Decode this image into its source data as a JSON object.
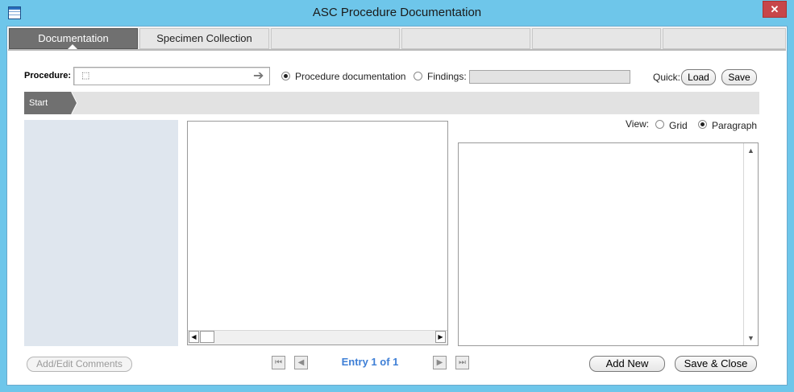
{
  "window": {
    "title": "ASC Procedure Documentation",
    "close_glyph": "✕",
    "app_icon": "app-window-icon"
  },
  "tabs": [
    {
      "label": "Documentation",
      "active": true
    },
    {
      "label": "Specimen Collection",
      "active": false
    },
    {
      "label": "",
      "active": false
    },
    {
      "label": "",
      "active": false
    },
    {
      "label": "",
      "active": false
    },
    {
      "label": "",
      "active": false
    }
  ],
  "procedure": {
    "label": "Procedure:",
    "value": "",
    "search_icon": "lookup-icon",
    "go_glyph": "➔"
  },
  "mode": {
    "procedure_doc_label": "Procedure documentation",
    "findings_label": "Findings:",
    "selected": "procedure_documentation",
    "findings_value": ""
  },
  "quick": {
    "label": "Quick:",
    "load_label": "Load",
    "save_label": "Save"
  },
  "breadcrumb": {
    "items": [
      "Start"
    ]
  },
  "view": {
    "label": "View:",
    "grid_label": "Grid",
    "paragraph_label": "Paragraph",
    "selected": "paragraph"
  },
  "scroll": {
    "left": "◀",
    "right": "▶",
    "up": "▲",
    "down": "▼"
  },
  "footer": {
    "add_edit_comments": "Add/Edit Comments",
    "entry_text": "Entry 1 of 1",
    "add_new": "Add New",
    "save_close": "Save & Close",
    "first": "⏮",
    "prev": "◀",
    "next": "▶",
    "last": "⏭"
  },
  "colors": {
    "accent": "#3e7fd6",
    "tab_active": "#707070",
    "titlebar": "#6ec6ea",
    "close": "#c7464a"
  }
}
